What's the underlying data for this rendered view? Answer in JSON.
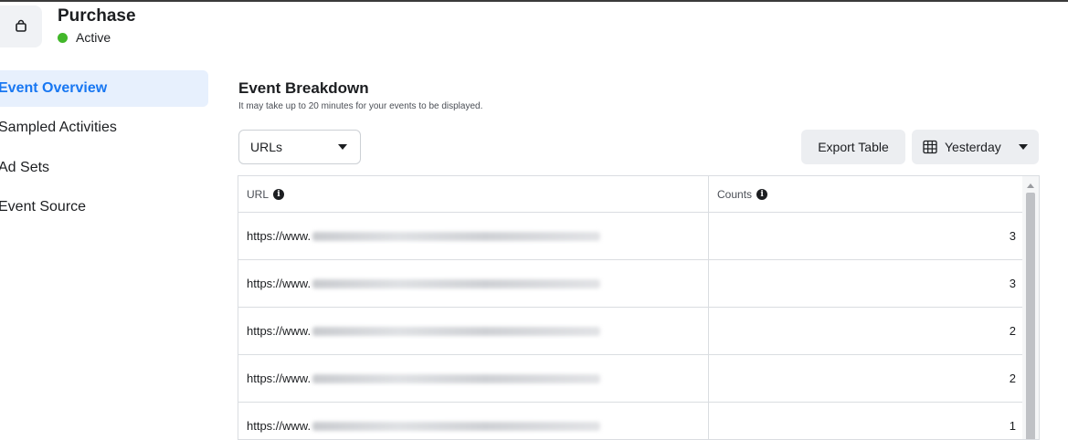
{
  "header": {
    "title": "Purchase",
    "status": "Active",
    "status_color": "#42b72a",
    "icon": "shopping-bag-icon"
  },
  "sidebar": {
    "items": [
      {
        "label": "Event Overview",
        "active": true
      },
      {
        "label": "Sampled Activities",
        "active": false
      },
      {
        "label": "Ad Sets",
        "active": false
      },
      {
        "label": "Event Source",
        "active": false
      }
    ]
  },
  "main": {
    "title": "Event Breakdown",
    "subtitle": "It may take up to 20 minutes for your events to be displayed.",
    "breakdown_select": {
      "value": "URLs"
    },
    "export_label": "Export Table",
    "date_range": {
      "value": "Yesterday",
      "icon": "calendar-grid-icon"
    },
    "accent_color": "#1877f2"
  },
  "table": {
    "columns": {
      "url": "URL",
      "counts": "Counts"
    },
    "rows": [
      {
        "url": "https://www.",
        "count": "3"
      },
      {
        "url": "https://www.",
        "count": "3"
      },
      {
        "url": "https://www.",
        "count": "2"
      },
      {
        "url": "https://www.",
        "count": "2"
      },
      {
        "url": "https://www.",
        "count": "1"
      }
    ]
  }
}
